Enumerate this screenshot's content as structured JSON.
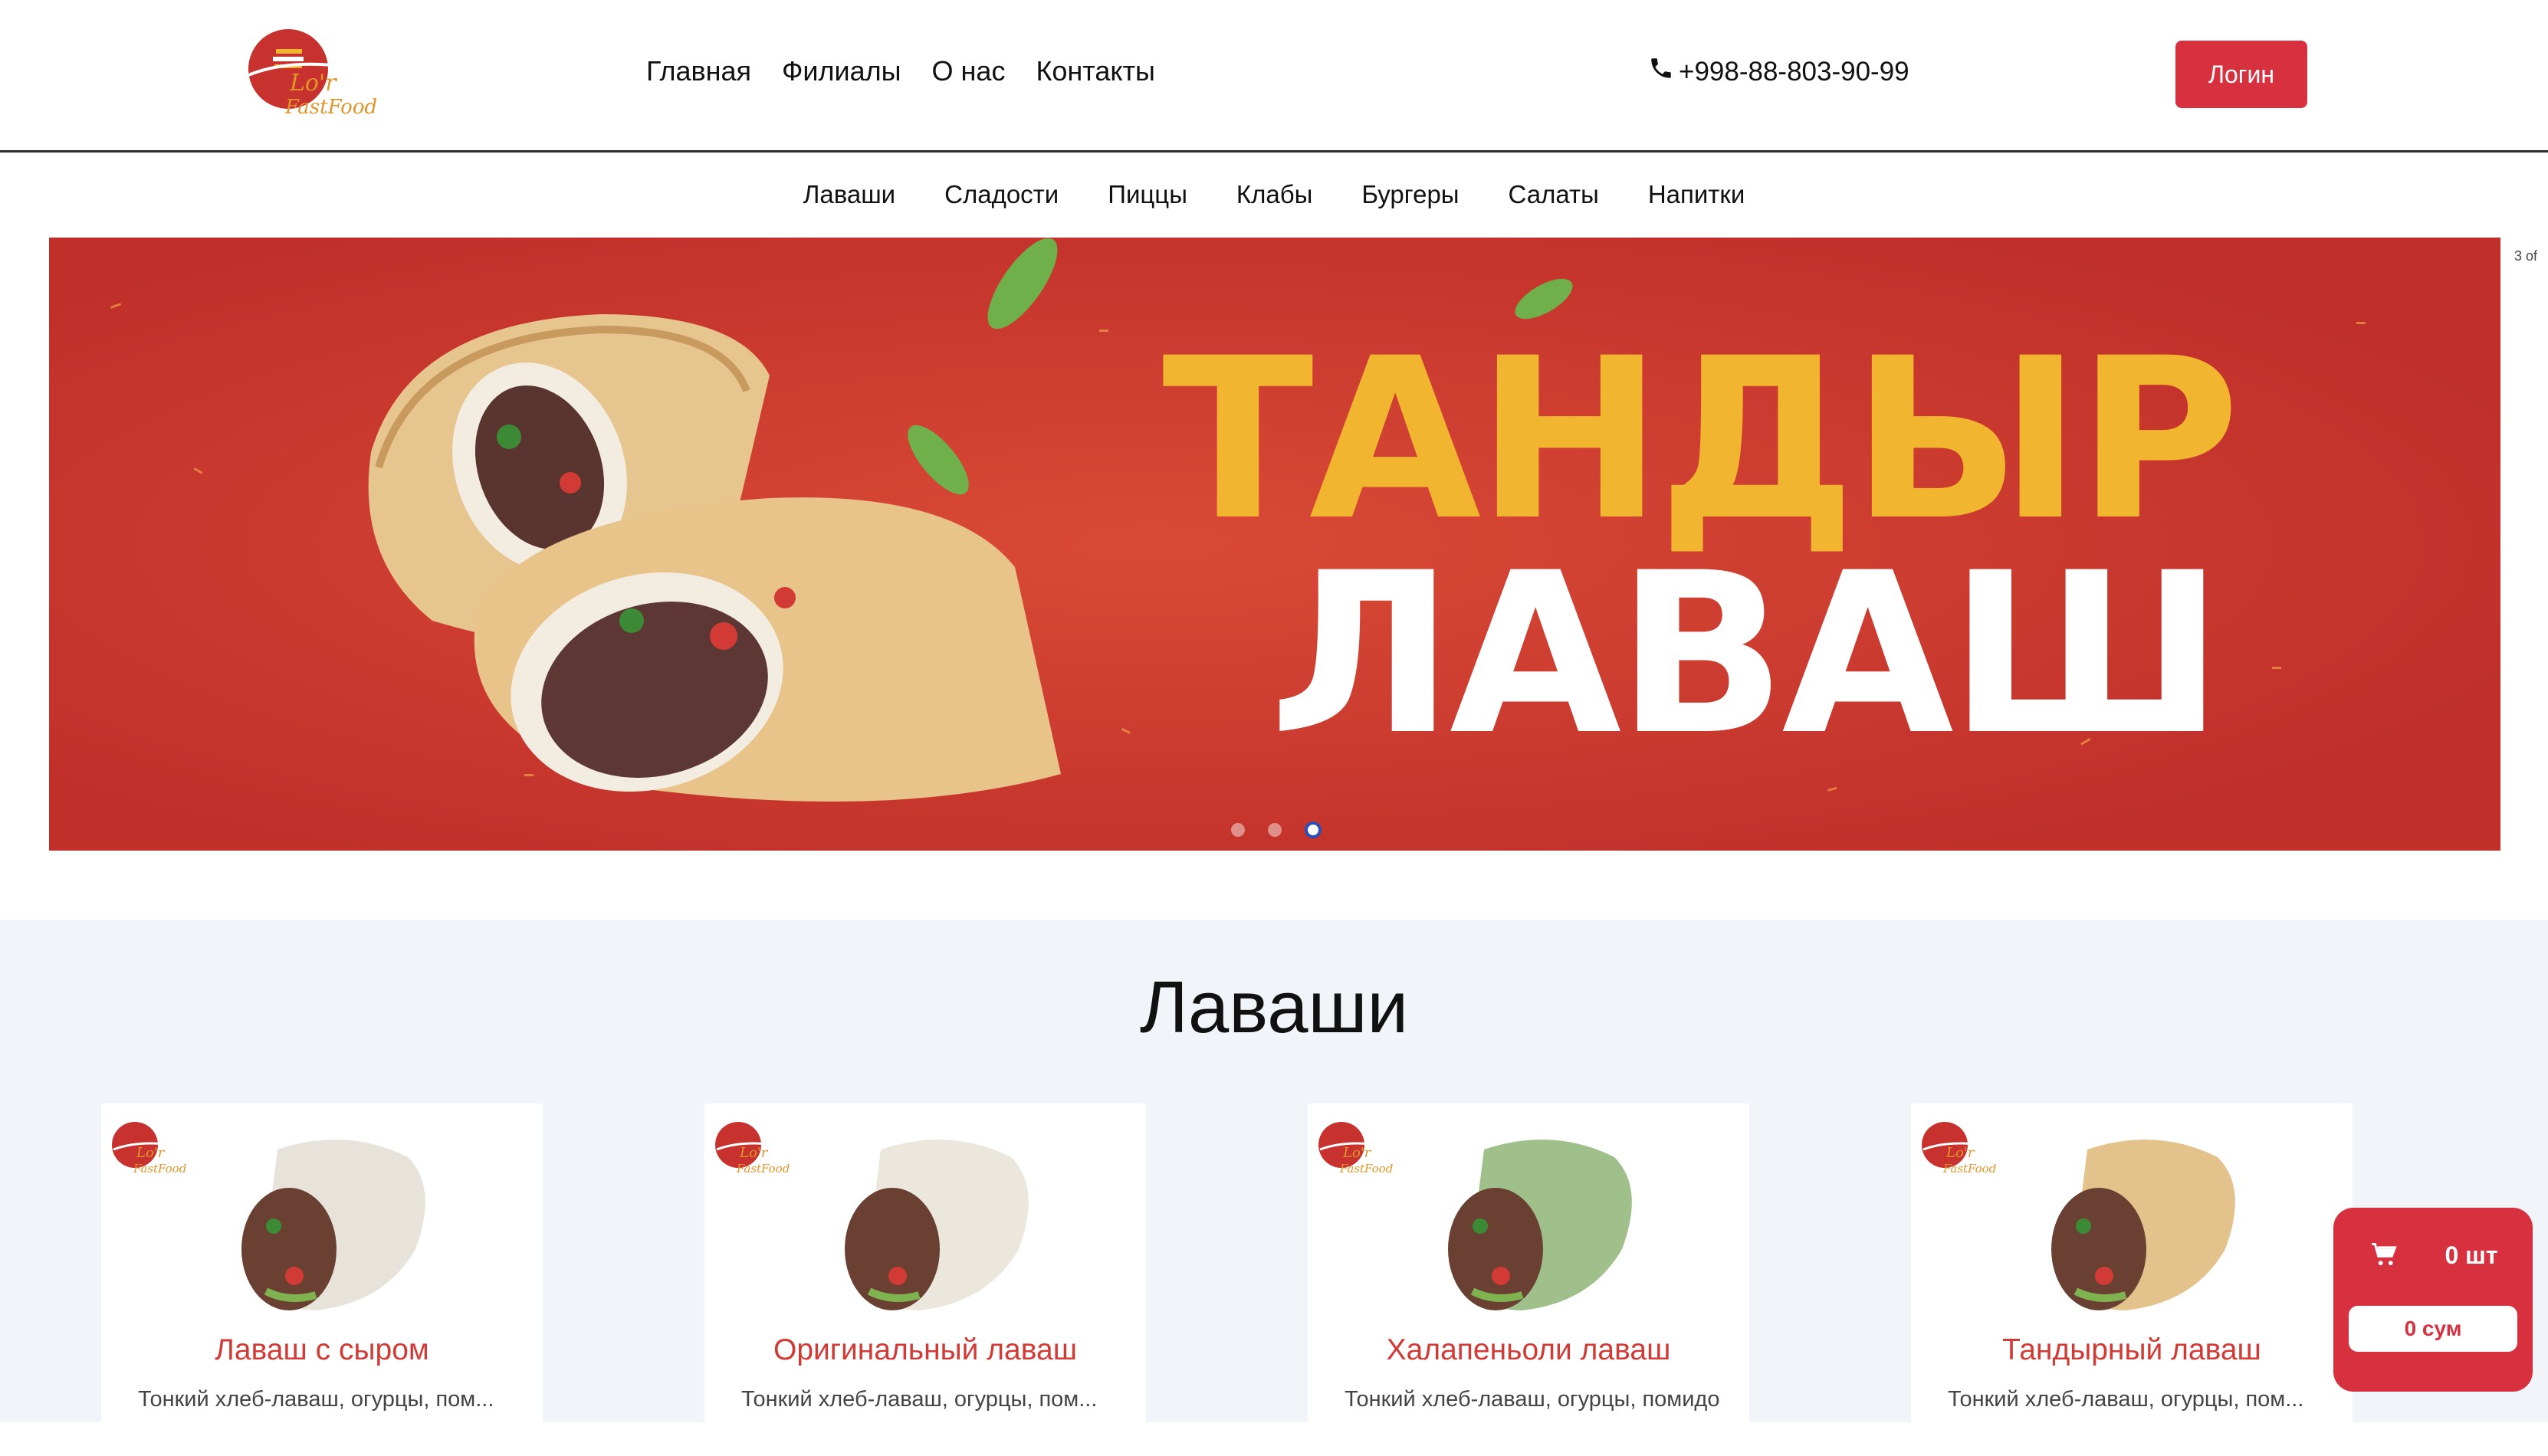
{
  "brand": {
    "logo_text": "Lo'r FastFood"
  },
  "nav": {
    "items": [
      "Главная",
      "Филиалы",
      "О нас",
      "Контакты"
    ]
  },
  "contact": {
    "phone": "+998-88-803-90-99"
  },
  "auth": {
    "login_label": "Логин"
  },
  "categories": [
    "Лаваши",
    "Сладости",
    "Пиццы",
    "Клабы",
    "Бургеры",
    "Салаты",
    "Напитки"
  ],
  "banner": {
    "line1": "ТАНДЫР",
    "line2": "ЛАВАШ",
    "counter": "3 of",
    "slides_total": 3,
    "active_slide": 3
  },
  "section": {
    "title": "Лаваши"
  },
  "products": [
    {
      "name": "Лаваш с сыром",
      "desc": "Тонкий хлеб-лаваш, огурцы, пом...",
      "wrap_color": "#e8e3da"
    },
    {
      "name": "Оригинальный лаваш",
      "desc": "Тонкий хлеб-лаваш, огурцы, пом...",
      "wrap_color": "#ece7dd"
    },
    {
      "name": "Халапеньоли лаваш",
      "desc": "Тонкий хлеб-лаваш, огурцы, помидо",
      "wrap_color": "#9fc08a"
    },
    {
      "name": "Тандырный лаваш",
      "desc": "Тонкий хлеб-лаваш, огурцы, пом...",
      "wrap_color": "#e3c28c"
    }
  ],
  "cart": {
    "count": "0 шт",
    "sum": "0 сум"
  },
  "colors": {
    "accent": "#d7303f",
    "banner_bg": "#c9342c",
    "title_yellow": "#f2b52f",
    "section_bg": "#f1f4f9"
  }
}
